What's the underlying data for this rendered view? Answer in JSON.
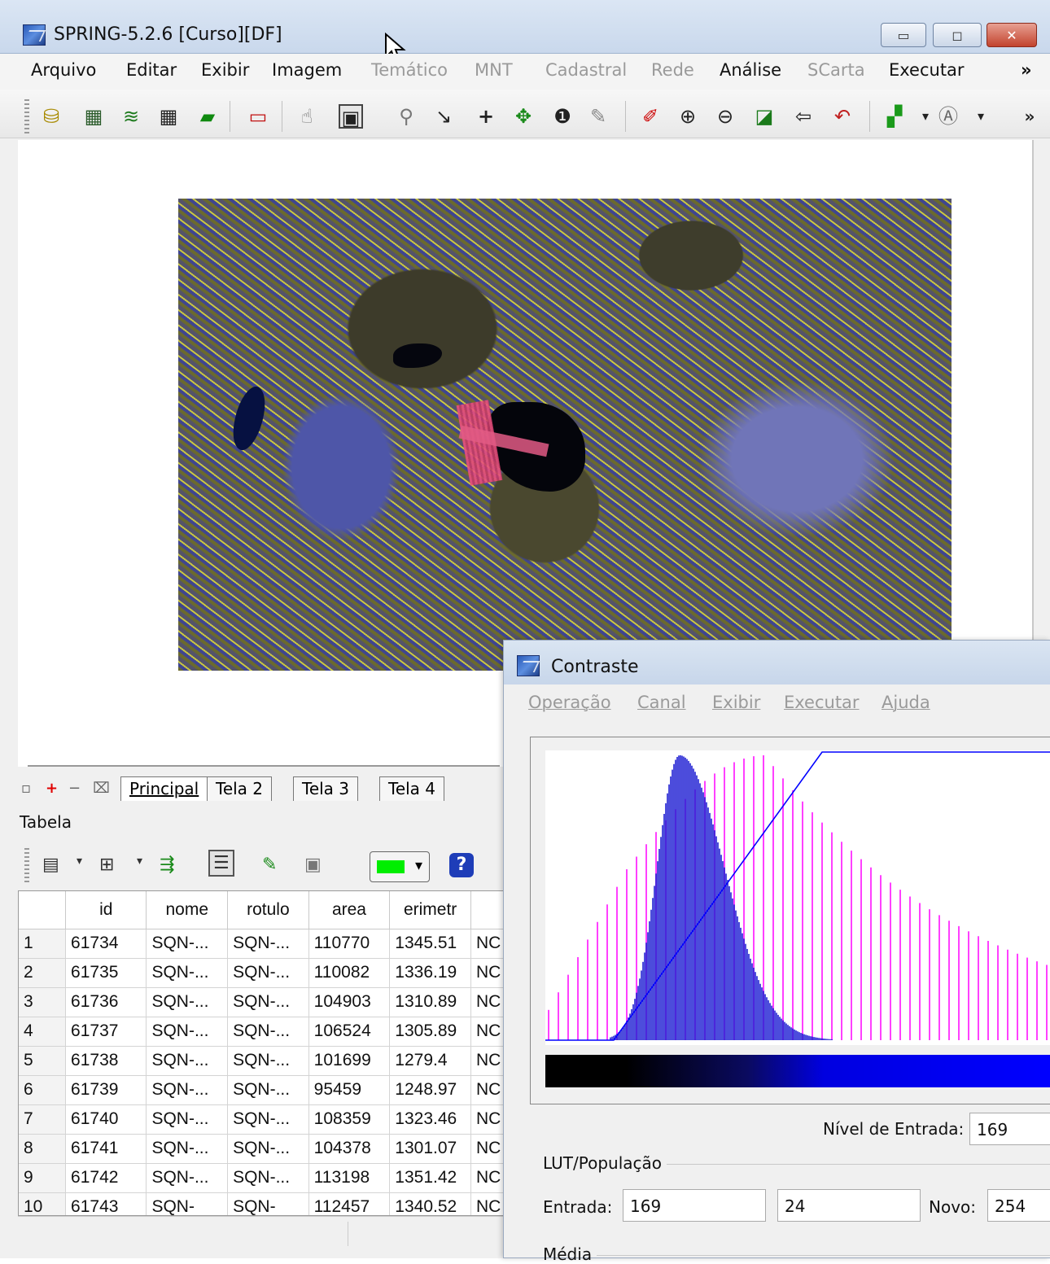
{
  "window": {
    "title": "SPRING-5.2.6 [Curso][DF]"
  },
  "menubar": {
    "items": [
      {
        "label": "Arquivo",
        "enabled": true
      },
      {
        "label": "Editar",
        "enabled": true
      },
      {
        "label": "Exibir",
        "enabled": true
      },
      {
        "label": "Imagem",
        "enabled": true
      },
      {
        "label": "Temático",
        "enabled": false
      },
      {
        "label": "MNT",
        "enabled": false
      },
      {
        "label": "Cadastral",
        "enabled": false
      },
      {
        "label": "Rede",
        "enabled": false
      },
      {
        "label": "Análise",
        "enabled": true
      },
      {
        "label": "SCarta",
        "enabled": false
      },
      {
        "label": "Executar",
        "enabled": true
      }
    ],
    "overflow": "»"
  },
  "toolbar": {
    "icons": [
      "database-icon",
      "image-icon",
      "layers-icon",
      "grid-icon",
      "plane-icon",
      "rectangle-icon",
      "cursor-icon",
      "info-panel-icon",
      "search-icon",
      "down-arrow-icon",
      "plus-icon",
      "pan-icon",
      "info-icon",
      "brush-icon",
      "pencil-icon",
      "zoom-in-icon",
      "zoom-out-icon",
      "zoom-area-icon",
      "back-icon",
      "undo-icon",
      "export-icon",
      "label-icon"
    ],
    "overflow": "»"
  },
  "tabs": {
    "items": [
      "Principal",
      "Tela 2",
      "Tela 3",
      "Tela 4"
    ],
    "active": "Principal"
  },
  "tabela": {
    "label": "Tabela",
    "columns": [
      "id",
      "nome",
      "rotulo",
      "area",
      "erimetr"
    ],
    "rows": [
      {
        "n": "1",
        "id": "61734",
        "nome": "SQN-...",
        "rotulo": "SQN-...",
        "area": "110770",
        "perimetro": "1345.51",
        "extra": "NC"
      },
      {
        "n": "2",
        "id": "61735",
        "nome": "SQN-...",
        "rotulo": "SQN-...",
        "area": "110082",
        "perimetro": "1336.19",
        "extra": "NC"
      },
      {
        "n": "3",
        "id": "61736",
        "nome": "SQN-...",
        "rotulo": "SQN-...",
        "area": "104903",
        "perimetro": "1310.89",
        "extra": "NC"
      },
      {
        "n": "4",
        "id": "61737",
        "nome": "SQN-...",
        "rotulo": "SQN-...",
        "area": "106524",
        "perimetro": "1305.89",
        "extra": "NC"
      },
      {
        "n": "5",
        "id": "61738",
        "nome": "SQN-...",
        "rotulo": "SQN-...",
        "area": "101699",
        "perimetro": "1279.4",
        "extra": "NC"
      },
      {
        "n": "6",
        "id": "61739",
        "nome": "SQN-...",
        "rotulo": "SQN-...",
        "area": "95459",
        "perimetro": "1248.97",
        "extra": "NC"
      },
      {
        "n": "7",
        "id": "61740",
        "nome": "SQN-...",
        "rotulo": "SQN-...",
        "area": "108359",
        "perimetro": "1323.46",
        "extra": "NC"
      },
      {
        "n": "8",
        "id": "61741",
        "nome": "SQN-...",
        "rotulo": "SQN-...",
        "area": "104378",
        "perimetro": "1301.07",
        "extra": "NC"
      },
      {
        "n": "9",
        "id": "61742",
        "nome": "SQN-...",
        "rotulo": "SQN-...",
        "area": "113198",
        "perimetro": "1351.42",
        "extra": "NC"
      },
      {
        "n": "10",
        "id": "61743",
        "nome": "SQN-",
        "rotulo": "SQN-",
        "area": "112457",
        "perimetro": "1340.52",
        "extra": "NC"
      }
    ]
  },
  "contraste": {
    "title": "Contraste",
    "menu": [
      "Operação",
      "Canal",
      "Exibir",
      "Executar",
      "Ajuda"
    ],
    "nivel_entrada_label": "Nível de Entrada:",
    "nivel_entrada_value": "169",
    "lut_group_label": "LUT/População",
    "entrada_label": "Entrada:",
    "entrada_value": "169",
    "populacao_value": "24",
    "novo_label": "Novo:",
    "novo_value": "254",
    "media_label": "Média",
    "colors": {
      "histogram_out": "#ff00ff",
      "histogram_in": "#0000cc",
      "lut_line": "#0000ff"
    }
  }
}
